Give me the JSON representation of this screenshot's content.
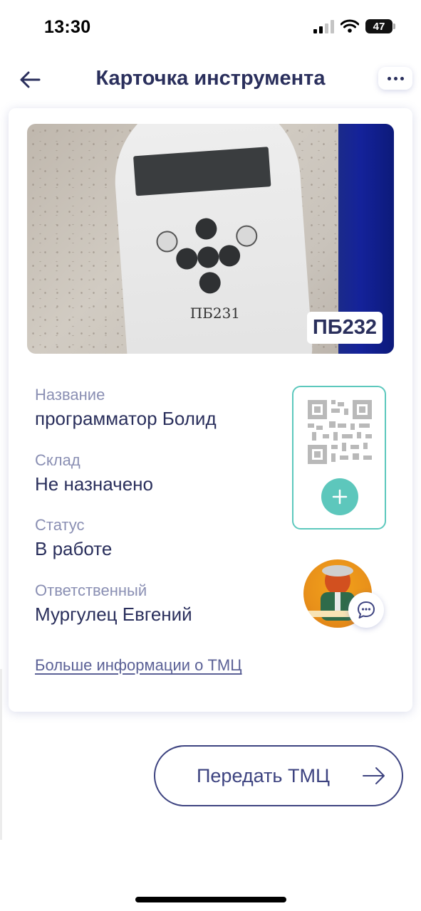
{
  "status_bar": {
    "time": "13:30",
    "battery": "47"
  },
  "header": {
    "title": "Карточка инструмента"
  },
  "photo": {
    "tag": "ПБ232",
    "device_label": "ПБ231"
  },
  "fields": [
    {
      "label": "Название",
      "value": "программатор Болид"
    },
    {
      "label": "Склад",
      "value": "Не назначено"
    },
    {
      "label": "Статус",
      "value": "В работе"
    },
    {
      "label": "Ответственный",
      "value": "Мургулец Евгений"
    }
  ],
  "more_info_link": "Больше информации о ТМЦ",
  "transfer_button": {
    "label": "Передать ТМЦ"
  },
  "colors": {
    "primary": "#2a2f5c",
    "accent": "#5dc7bc",
    "label": "#8a8fb3"
  },
  "icons": [
    "back-arrow-icon",
    "more-dots-icon",
    "qr-code-icon",
    "plus-icon",
    "chat-icon",
    "arrow-right-icon",
    "wifi-icon",
    "signal-icon",
    "battery-icon"
  ]
}
